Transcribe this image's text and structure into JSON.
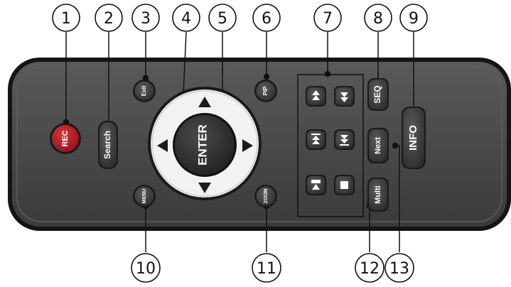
{
  "callouts": [
    "1",
    "2",
    "3",
    "4",
    "5",
    "6",
    "7",
    "8",
    "9",
    "10",
    "11",
    "12",
    "13"
  ],
  "buttons": {
    "rec": "REC",
    "search": "Search",
    "exit": "Exit",
    "menu": "MENU",
    "pip": "PIP",
    "zoom": "ZOOM",
    "enter": "ENTER",
    "seq": "SEQ",
    "next": "Next",
    "multi": "Multi",
    "info": "INFO"
  },
  "colors": {
    "body": "#4a4a4a",
    "body_edge": "#1a1a1a",
    "button": "#3b3b3b",
    "rec": "#b3121b",
    "ring": "#f2f2f2",
    "enter": "#2f2f2f"
  }
}
